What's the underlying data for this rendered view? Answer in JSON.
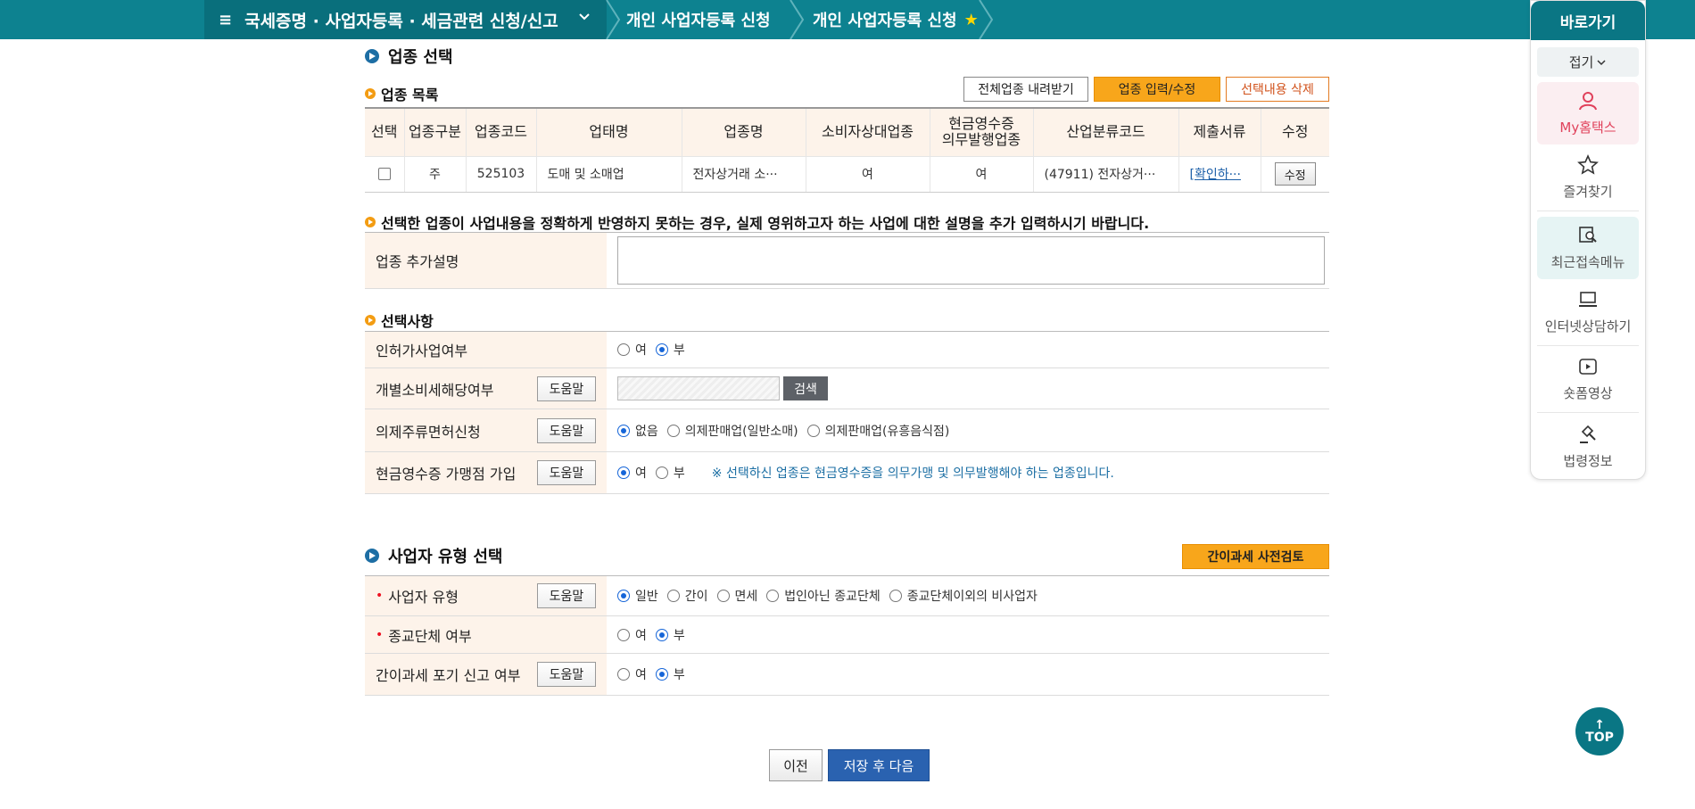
{
  "topbar": {
    "menu_title": "국세증명 · 사업자등록 · 세금관련 신청/신고",
    "crumb1": "개인 사업자등록 신청",
    "crumb2": "개인 사업자등록 신청"
  },
  "quick": {
    "title": "바로가기",
    "fold": "접기",
    "items": [
      "My홈택스",
      "즐겨찾기",
      "최근접속메뉴",
      "인터넷상담하기",
      "숏폼영상",
      "법령정보"
    ]
  },
  "job_section": {
    "title": "업종 선택",
    "list_title": "업종 목록",
    "btn_download": "전체업종 내려받기",
    "btn_input": "업종 입력/수정",
    "btn_delete": "선택내용 삭제",
    "headers": [
      "선택",
      "업종구분",
      "업종코드",
      "업태명",
      "업종명",
      "소비자상대업종",
      "현금영수증\n의무발행업종",
      "산업분류코드",
      "제출서류",
      "수정"
    ],
    "header_cash_line1": "현금영수증",
    "header_cash_line2": "의무발행업종",
    "row": {
      "type": "주",
      "code": "525103",
      "biz": "도매 및 소매업",
      "name": "전자상거래 소···",
      "consumer": "여",
      "cash": "여",
      "industry": "(47911) 전자상거···",
      "docs": "[확인하···",
      "edit": "수정"
    },
    "extra_notice": "선택한 업종이 사업내용을 정확하게 반영하지 못하는 경우, 실제 영위하고자 하는 사업에 대한 설명을 추가 입력하시기 바랍니다.",
    "extra_label": "업종 추가설명",
    "extra_value": ""
  },
  "options": {
    "title": "선택사항",
    "rows": [
      {
        "label": "인허가사업여부"
      },
      {
        "label": "개별소비세해당여부",
        "help": "도움말",
        "search": "검색"
      },
      {
        "label": "의제주류면허신청",
        "help": "도움말",
        "opts": [
          "없음",
          "의제판매업(일반소매)",
          "의제판매업(유흥음식점)"
        ]
      },
      {
        "label": "현금영수증 가맹점 가입",
        "help": "도움말",
        "note": "※ 선택하신 업종은 현금영수증을 의무가맹 및 의무발행해야 하는 업종입니다."
      }
    ],
    "yes": "여",
    "no": "부"
  },
  "biz_type": {
    "title": "사업자 유형 선택",
    "btn_review": "간이과세 사전검토",
    "rows": [
      {
        "label": "사업자 유형",
        "help": "도움말",
        "opts": [
          "일반",
          "간이",
          "면세",
          "법인아닌 종교단체",
          "종교단체이외의 비사업자"
        ]
      },
      {
        "label": "종교단체 여부"
      },
      {
        "label": "간이과세 포기 신고 여부",
        "help": "도움말"
      }
    ]
  },
  "nav": {
    "prev": "이전",
    "next": "저장 후 다음",
    "top": "TOP"
  }
}
